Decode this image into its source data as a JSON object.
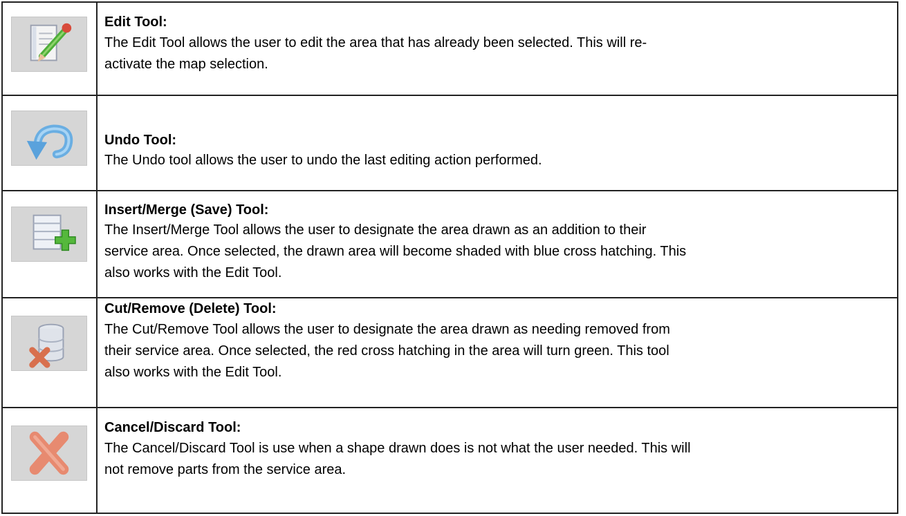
{
  "tools": [
    {
      "icon": "edit-icon",
      "title": "Edit Tool:",
      "lines": [
        "The Edit Tool allows the user to edit the area that has already been selected.  This will re-",
        "activate the map selection."
      ]
    },
    {
      "icon": "undo-icon",
      "title": "Undo Tool:",
      "lines": [
        "The Undo tool allows the user to undo the last editing action performed."
      ]
    },
    {
      "icon": "insert-merge-icon",
      "title": "Insert/Merge (Save) Tool:",
      "lines": [
        "The Insert/Merge Tool allows the user to designate the area drawn as an addition to their",
        "service area.  Once selected, the drawn area will become shaded with blue cross hatching.  This",
        "also works with the Edit Tool."
      ]
    },
    {
      "icon": "cut-remove-icon",
      "title": "Cut/Remove (Delete) Tool:",
      "lines": [
        "The Cut/Remove Tool allows the user to designate the area drawn as needing removed from",
        "their service area.  Once selected, the red cross hatching in the area will turn green.  This tool",
        "also works with the Edit Tool."
      ]
    },
    {
      "icon": "cancel-discard-icon",
      "title": "Cancel/Discard Tool:",
      "lines": [
        "The Cancel/Discard Tool is use when a shape drawn does is not what the user needed.  This will",
        "not remove parts from the service area."
      ]
    }
  ]
}
